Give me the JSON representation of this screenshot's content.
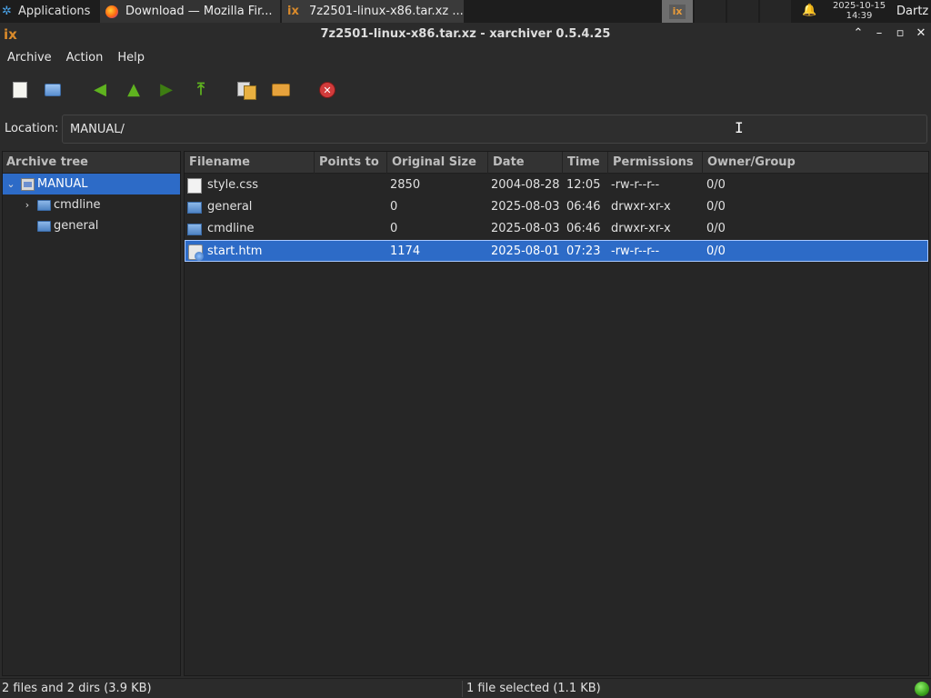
{
  "panel": {
    "applications_label": "Applications",
    "tasks": [
      {
        "label": "Download — Mozilla Fir..."
      },
      {
        "label": "7z2501-linux-x86.tar.xz ..."
      }
    ],
    "clock_date": "2025-10-15",
    "clock_time": "14:39",
    "user": "Dartz"
  },
  "window": {
    "title": "7z2501-linux-x86.tar.xz - xarchiver 0.5.4.25"
  },
  "menubar": {
    "items": [
      {
        "label": "Archive"
      },
      {
        "label": "Action"
      },
      {
        "label": "Help"
      }
    ]
  },
  "toolbar": {
    "icons": [
      "new-archive-icon",
      "open-archive-icon",
      "back-icon",
      "up-icon",
      "forward-icon",
      "home-icon",
      "add-files-icon",
      "extract-icon",
      "stop-icon"
    ]
  },
  "location": {
    "label": "Location:",
    "value": "MANUAL/"
  },
  "tree": {
    "header": "Archive tree",
    "nodes": [
      {
        "label": "MANUAL",
        "selected": true,
        "expanded": true
      },
      {
        "label": "cmdline",
        "expandable": true
      },
      {
        "label": "general"
      }
    ]
  },
  "filelist": {
    "columns": [
      "Filename",
      "Points to",
      "Original Size",
      "Date",
      "Time",
      "Permissions",
      "Owner/Group"
    ],
    "rows": [
      {
        "name": "style.css",
        "points_to": "",
        "size": "2850",
        "date": "2004-08-28",
        "time": "12:05",
        "perm": "-rw-r--r--",
        "owner": "0/0",
        "type": "file"
      },
      {
        "name": "general",
        "points_to": "",
        "size": "0",
        "date": "2025-08-03",
        "time": "06:46",
        "perm": "drwxr-xr-x",
        "owner": "0/0",
        "type": "folder"
      },
      {
        "name": "cmdline",
        "points_to": "",
        "size": "0",
        "date": "2025-08-03",
        "time": "06:46",
        "perm": "drwxr-xr-x",
        "owner": "0/0",
        "type": "folder"
      },
      {
        "name": "start.htm",
        "points_to": "",
        "size": "1174",
        "date": "2025-08-01",
        "time": "07:23",
        "perm": "-rw-r--r--",
        "owner": "0/0",
        "type": "html",
        "selected": true
      }
    ]
  },
  "status": {
    "left": "2 files and 2 dirs  (3.9 KB)",
    "right": "1 file selected (1.1 KB)"
  },
  "colors": {
    "selection": "#2d6bc7",
    "background": "#2b2b2b",
    "status_led": "#3aa11c"
  }
}
